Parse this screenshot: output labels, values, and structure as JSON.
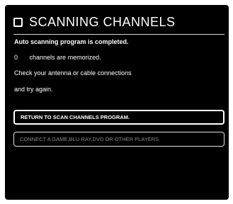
{
  "header": {
    "title": "SCANNING CHANNELS"
  },
  "messages": {
    "completed": "Auto scanning program is completed.",
    "channel_count": "0",
    "memorized_suffix": "channels are memorized.",
    "check_line": "Check your antenna or cable connections",
    "retry_line": "and try again."
  },
  "buttons": {
    "return_label": "RETURN TO SCAN CHANNELS PROGRAM.",
    "connect_label": "CONNECT A GAME,BLU-RAY,DVD OR OTHER PLAYERS"
  },
  "colors": {
    "background": "#000000",
    "text": "#ffffff",
    "disabled_text": "#8a8a8a"
  }
}
